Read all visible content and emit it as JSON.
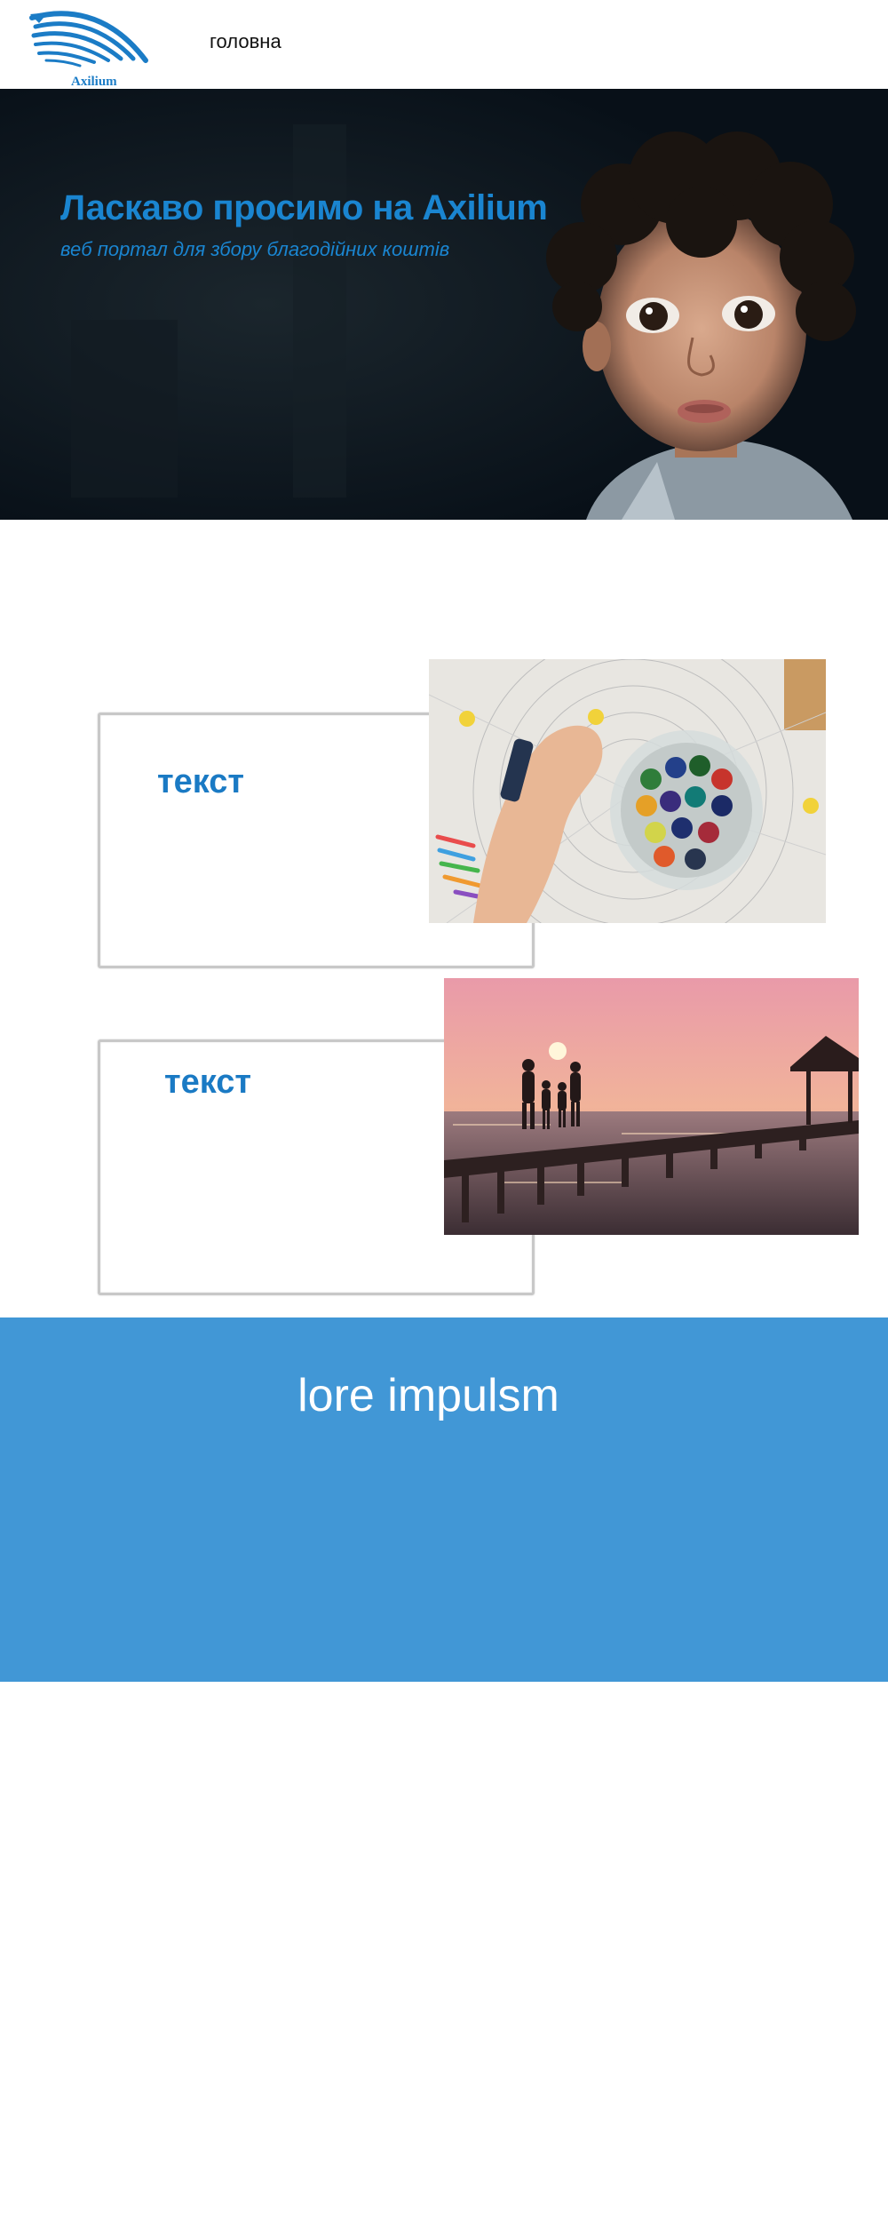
{
  "brand": {
    "name": "Axilium",
    "accent_color": "#1a85d0",
    "logo_icon": "wing-logo-icon"
  },
  "nav": {
    "items": [
      {
        "label": "головна"
      }
    ]
  },
  "hero": {
    "title": "Ласкаво просимо на Axilium",
    "subtitle": "веб портал для збору благодійних коштів",
    "image": "child-portrait-photo"
  },
  "features": [
    {
      "title": "текст",
      "image": "crayons-jar-photo"
    },
    {
      "title": "текст",
      "image": "family-sunset-pier-photo"
    }
  ],
  "band": {
    "title": "lore impulsm",
    "background_color": "#4197d6"
  }
}
